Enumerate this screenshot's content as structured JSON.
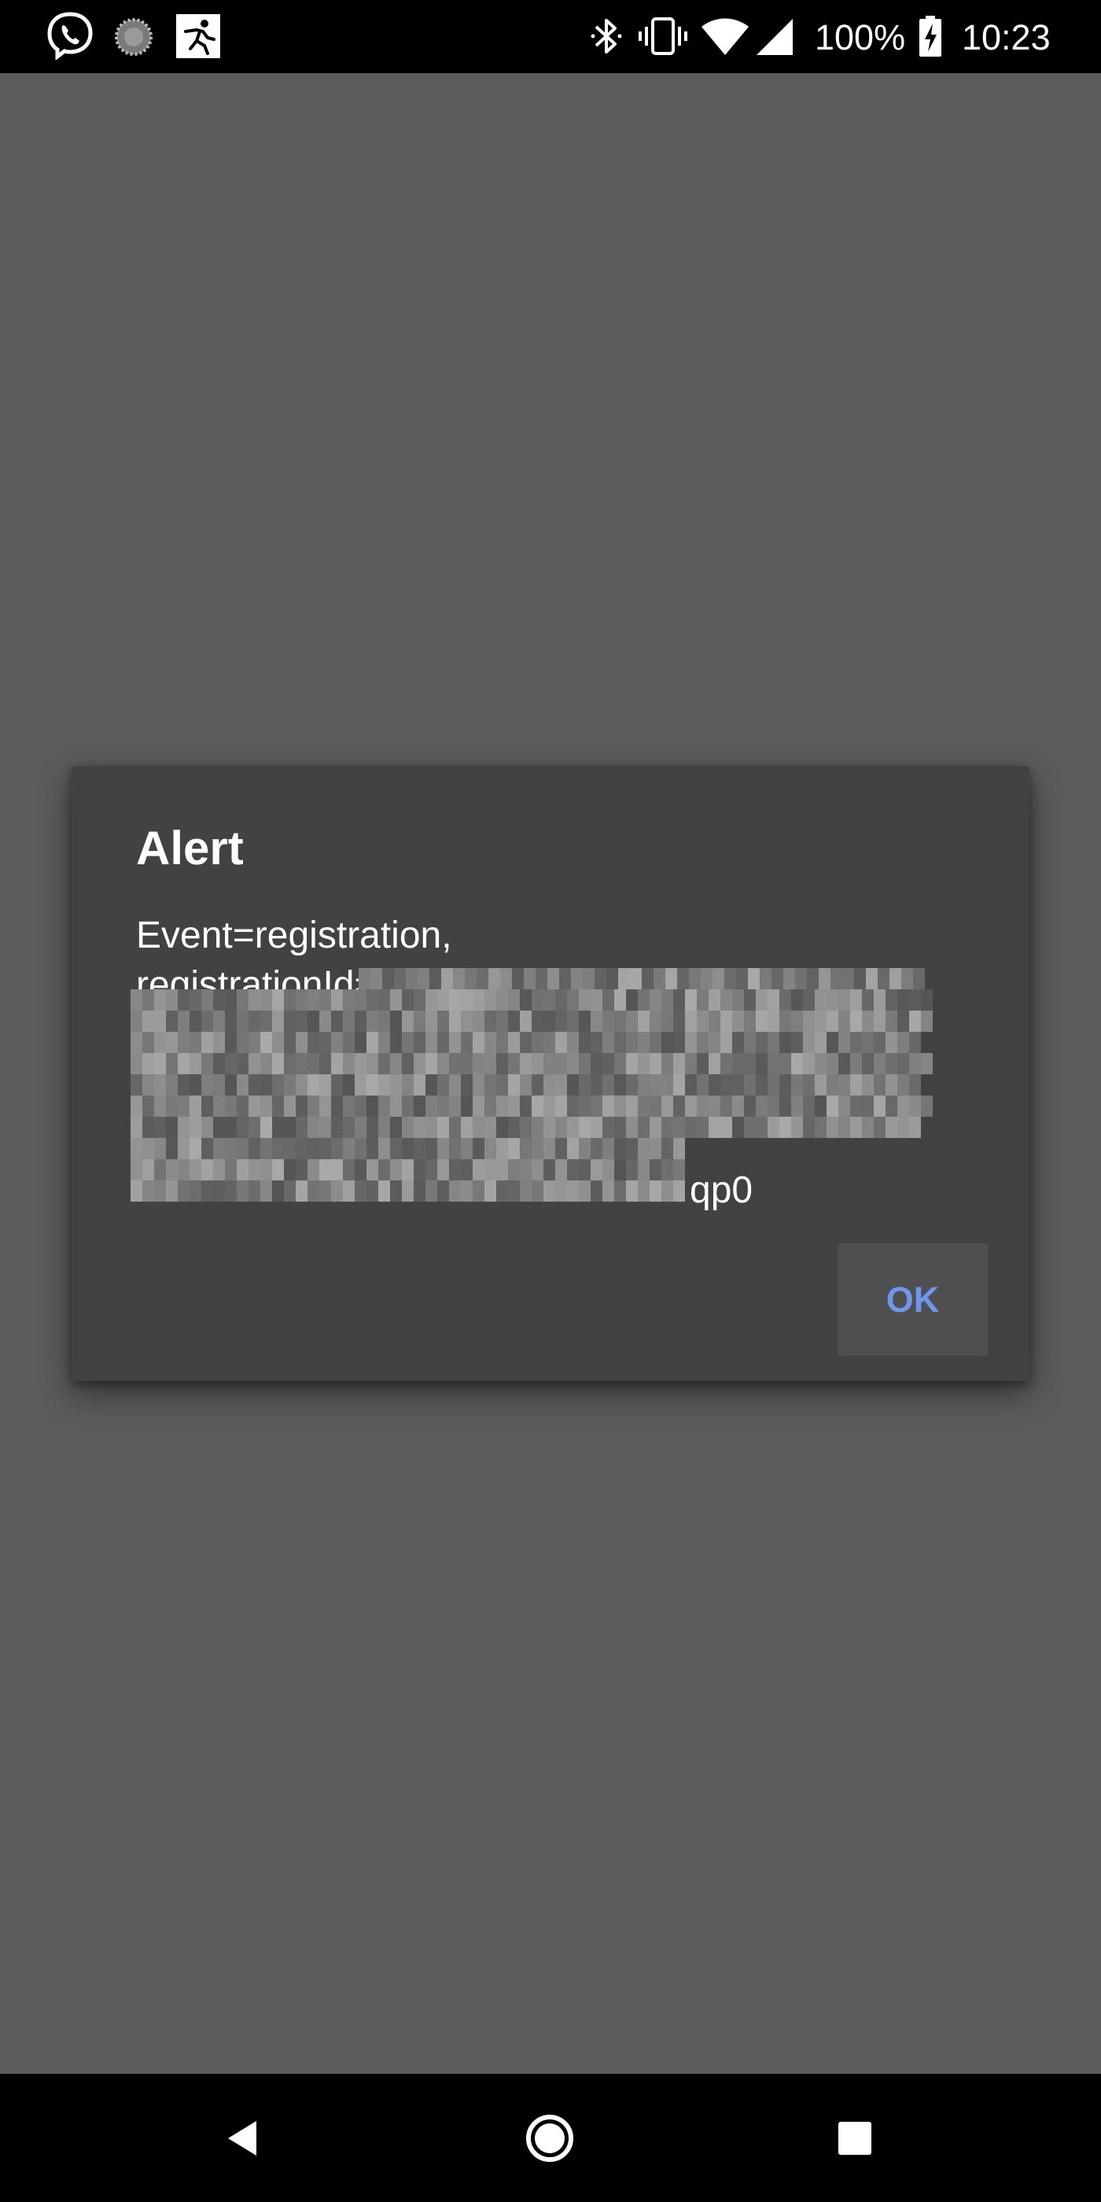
{
  "status_bar": {
    "notification_icons": [
      "viber-icon",
      "loader-icon",
      "runner-app-icon"
    ],
    "system_icons": [
      "bluetooth-icon",
      "vibrate-icon",
      "wifi-icon",
      "cell-signal-icon",
      "battery-charging-icon"
    ],
    "battery_percent": "100%",
    "time": "10:23"
  },
  "dialog": {
    "title": "Alert",
    "message_line_1": "Event=registration,",
    "message_line_2_prefix": "registrationId=daZx",
    "message_tail": "qp0",
    "ok_label": "OK",
    "ok_color": "#6f97f0",
    "background_color": "#424242"
  },
  "navigation": {
    "buttons": [
      "back-icon",
      "home-icon",
      "recents-icon"
    ]
  },
  "colors": {
    "scrim": "#5b5b5b",
    "bars": "#000000"
  }
}
